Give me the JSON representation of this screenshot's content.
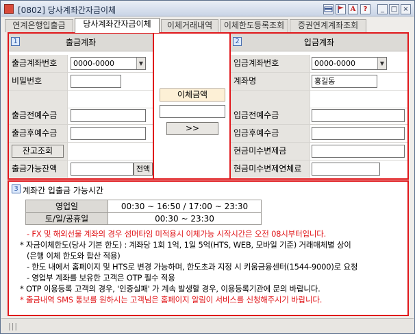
{
  "window": {
    "title": "[0802] 당사계좌간자금이체",
    "title_icons": [
      "card-icon",
      "flag-icon",
      "font-icon",
      "help-icon"
    ],
    "help_label": "?",
    "font_label": "A",
    "minimize_label": "_",
    "maximize_label": "□",
    "close_label": "×"
  },
  "tabs": [
    {
      "label": "연계은행입출금",
      "active": false
    },
    {
      "label": "당사계좌간자금이체",
      "active": true
    },
    {
      "label": "이체거래내역",
      "active": false
    },
    {
      "label": "이체한도등록조회",
      "active": false
    },
    {
      "label": "증권연계계좌조회",
      "active": false
    }
  ],
  "withdraw": {
    "section_number": "1",
    "header": "출금계좌",
    "account_label": "출금계좌번호",
    "account_value": "0000-0000",
    "password_label": "비밀번호",
    "password_value": "",
    "before_label": "출금전예수금",
    "before_value": "",
    "after_label": "출금후예수금",
    "after_value": "",
    "balance_button": "잔고조회",
    "available_label": "출금가능잔액",
    "available_value": "",
    "all_button": "전액"
  },
  "transfer": {
    "amount_label": "이체금액",
    "amount_value": "",
    "submit_button": ">>"
  },
  "deposit": {
    "section_number": "2",
    "header": "입금계좌",
    "account_label": "입금계좌번호",
    "account_value": "0000-0000",
    "name_label": "계좌명",
    "name_value": "홍길동",
    "before_label": "입금전예수금",
    "before_value": "",
    "after_label": "입금후예수금",
    "after_value": "",
    "unpaid_label": "현금미수변제금",
    "unpaid_value": "",
    "overdue_label": "현금미수변제연체료",
    "overdue_value": ""
  },
  "info": {
    "section_number": "3",
    "title": "계좌간 입출금 가능시간",
    "hours": [
      {
        "label": "영업일",
        "value": "00:30 ~ 16:50 / 17:00 ~ 23:30"
      },
      {
        "label": "토/일/공휴일",
        "value": "00:30 ~ 23:30"
      }
    ],
    "notes": [
      {
        "text": "- FX 및 해외선물 계좌의 경우 섬머타임 미적용시 이체가능 시작시간은 오전 08시부터입니다.",
        "color": "red",
        "indent": 18
      },
      {
        "text": "* 자금이체한도(당사 기본 한도) : 계좌당 1회 1억, 1일 5억(HTS, WEB, 모바일 기준) 거래매체별 상이",
        "color": "black",
        "indent": 8
      },
      {
        "text": "(은행 이체 한도와 합산 적용)",
        "color": "black",
        "indent": 18
      },
      {
        "text": "- 한도 내에서 홈페이지 및 HTS로 변경 가능하며, 한도초과 지정 시 키움금융센터(1544-9000)로 요청",
        "color": "black",
        "indent": 18
      },
      {
        "text": "- 영업부 계좌를 보유한 고객은 OTP 필수 적용",
        "color": "black",
        "indent": 18
      },
      {
        "text": "* OTP 이용등록 고객의 경우, '인증실패' 가 계속 발생할 경우, 이용등록기관에 문의 바랍니다.",
        "color": "black",
        "indent": 8
      },
      {
        "text": "* 출금내역 SMS 통보를 원하시는 고객님은 홈페이지 알림이 서비스를 신청해주시기 바랍니다.",
        "color": "red",
        "indent": 8
      }
    ]
  },
  "status": {
    "grip_label": "|||"
  },
  "colors": {
    "accent_red": "#e0161a",
    "section_blue": "#2a58a8"
  }
}
